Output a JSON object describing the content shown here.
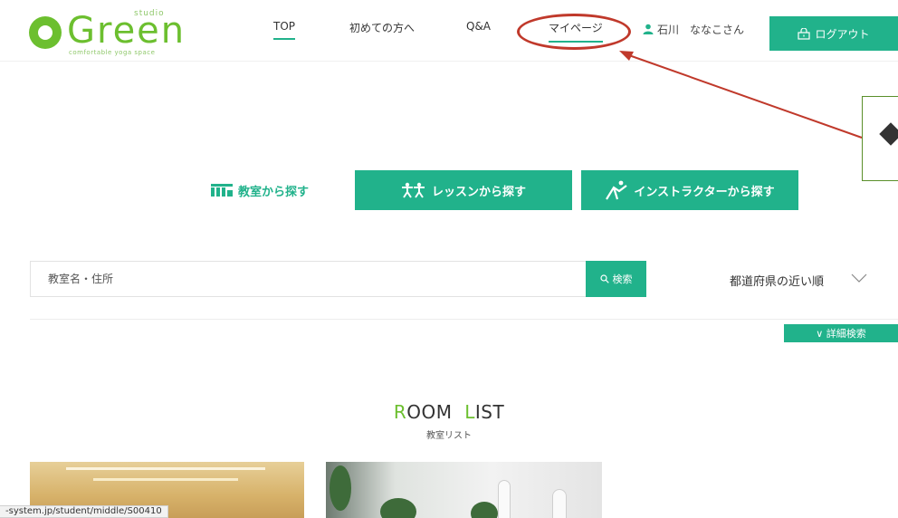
{
  "header": {
    "logo": {
      "small": "studio",
      "main": "Green",
      "tagline": "comfortable yoga space"
    },
    "nav": [
      {
        "label": "TOP"
      },
      {
        "label": "初めての方へ"
      },
      {
        "label": "Q&A"
      },
      {
        "label": "マイページ"
      }
    ],
    "user_name": "石川　ななこさん",
    "logout_label": "ログアウト"
  },
  "tabs": {
    "room": "教室から探す",
    "lesson": "レッスンから探す",
    "instructor": "インストラクターから探す"
  },
  "search": {
    "placeholder": "教室名・住所",
    "button_label": "検索",
    "sort_selected": "都道府県の近い順",
    "detail_label": "∨ 詳細検索"
  },
  "room_list": {
    "title_r": "R",
    "title_oom": "OOM",
    "title_l": "L",
    "title_ist": "IST",
    "subtitle": "教室リスト"
  },
  "status_url": "-system.jp/student/middle/S00410",
  "colors": {
    "accent": "#21b28b",
    "brand": "#6cbf2f",
    "annotation": "#c0392b"
  }
}
